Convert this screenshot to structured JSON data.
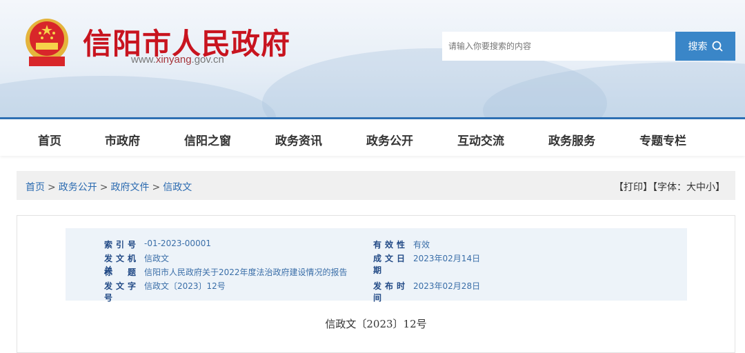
{
  "header": {
    "title": "信阳市人民政府",
    "url_prefix": "www.",
    "url_mid": "xinyang",
    "url_suffix": ".gov.cn",
    "search_placeholder": "请输入你要搜索的内容",
    "search_button": "搜索"
  },
  "nav": [
    "首页",
    "市政府",
    "信阳之窗",
    "政务资讯",
    "政务公开",
    "互动交流",
    "政务服务",
    "专题专栏"
  ],
  "breadcrumb": [
    "首页",
    "政务公开",
    "政府文件",
    "信政文"
  ],
  "tools": {
    "print": "【打印】",
    "font": "【字体：大中小】"
  },
  "info": {
    "index_label": "索引号",
    "index_value": "-01-2023-00001",
    "validity_label": "有效性",
    "validity_value": "有效",
    "issuer_label": "发文机关",
    "issuer_value": "信政文",
    "date_label": "成文日期",
    "date_value": "2023年02月14日",
    "title_label": "标题",
    "title_value": "信阳市人民政府关于2022年度法治政府建设情况的报告",
    "docno_label": "发文字号",
    "docno_value": "信政文〔2023〕12号",
    "pub_label": "发布时间",
    "pub_value": "2023年02月28日"
  },
  "doc_number": "信政文〔2023〕12号"
}
